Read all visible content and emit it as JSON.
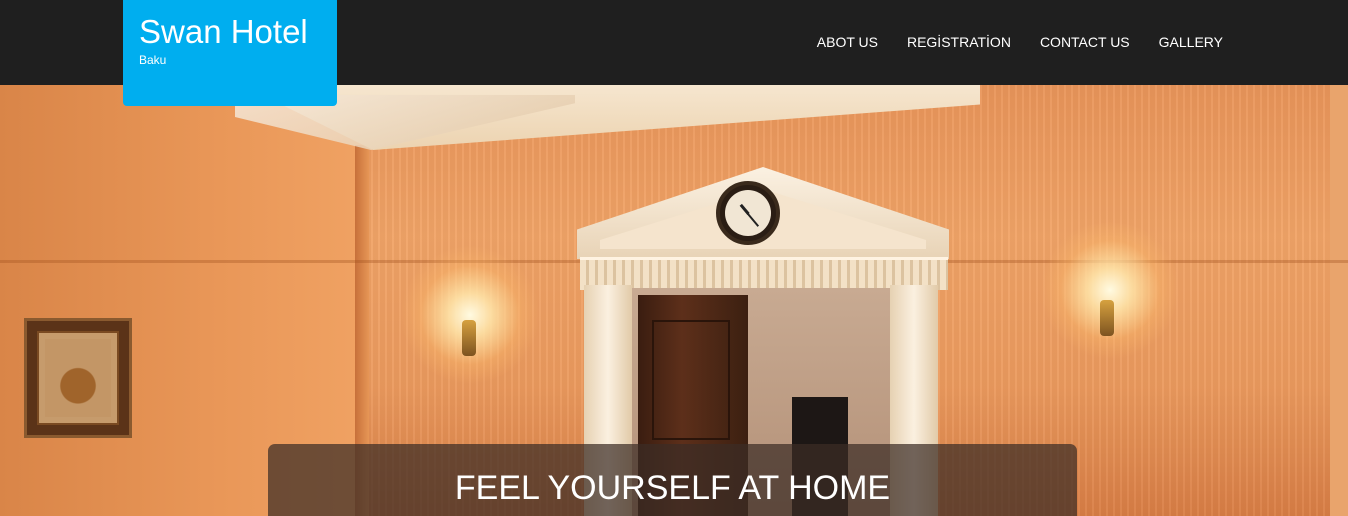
{
  "brand": {
    "title": "Swan Hotel",
    "subtitle": "Baku"
  },
  "nav": {
    "items": [
      {
        "label": "ABOT US"
      },
      {
        "label": "REGİSTRATİON"
      },
      {
        "label": "CONTACT US"
      },
      {
        "label": "GALLERY"
      }
    ]
  },
  "hero": {
    "caption": "FEEL YOURSELF AT HOME"
  },
  "colors": {
    "brand_accent": "#00aeef",
    "navbar_bg": "#1f1f1f",
    "caption_bg": "#3c2d26"
  },
  "icons": {
    "hero_image": "hotel-hallway-photo"
  }
}
